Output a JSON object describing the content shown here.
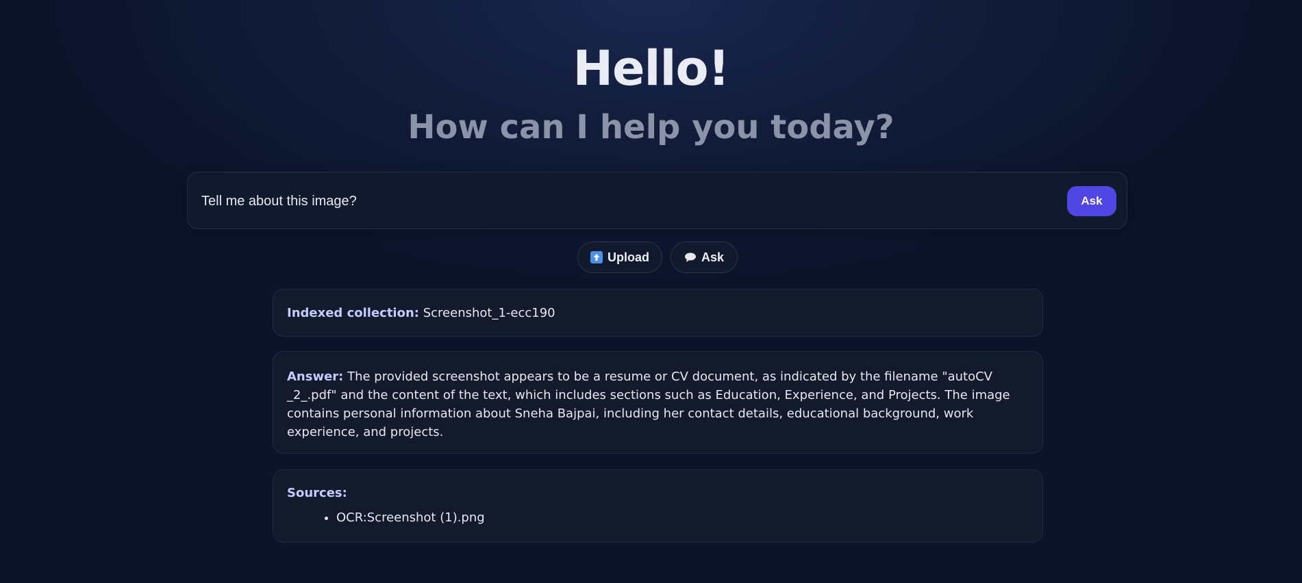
{
  "hero": {
    "title": "Hello!",
    "subtitle": "How can I help you today?"
  },
  "search": {
    "value": "Tell me about this image?",
    "placeholder": "",
    "ask_label": "Ask"
  },
  "actions": {
    "upload_label": "Upload",
    "upload_icon": "upload-arrow-icon",
    "ask_label": "Ask",
    "ask_icon": "speech-bubble-icon"
  },
  "collection": {
    "label": "Indexed collection:",
    "value": "Screenshot_1-ecc190"
  },
  "answer": {
    "label": "Answer:",
    "text": "The provided screenshot appears to be a resume or CV document, as indicated by the filename \"autoCV _2_.pdf\" and the content of the text, which includes sections such as Education, Experience, and Projects. The image contains personal information about Sneha Bajpai, including her contact details, educational background, work experience, and projects."
  },
  "sources": {
    "label": "Sources:",
    "items": [
      "OCR:Screenshot (1).png"
    ]
  },
  "colors": {
    "accent": "#5046e5",
    "label_text": "#c3ccff",
    "background": "#0c142a",
    "card_background": "#121a2b"
  }
}
